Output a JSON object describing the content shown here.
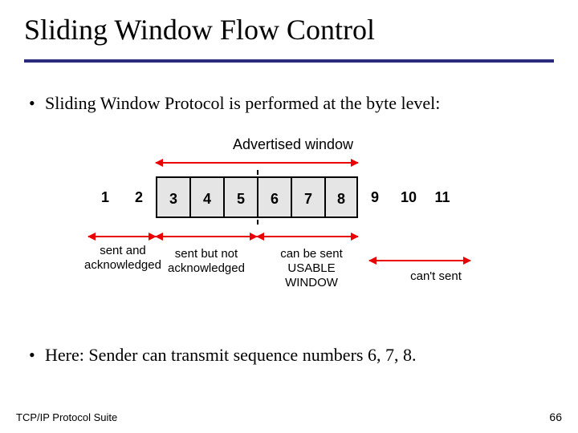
{
  "slide": {
    "title": "Sliding Window Flow Control",
    "bullet1": "Sliding Window Protocol is performed at the byte level:",
    "bullet2": "Here: Sender can transmit sequence numbers 6, 7, 8.",
    "footer_left": "TCP/IP Protocol Suite",
    "footer_right": "66"
  },
  "diagram": {
    "advertised_label": "Advertised window",
    "cells": [
      "1",
      "2",
      "3",
      "4",
      "5",
      "6",
      "7",
      "8",
      "9",
      "10",
      "11"
    ],
    "window_start_index": 2,
    "window_end_index": 7,
    "pointer_after_sent_index": 5,
    "labels": {
      "sent_ack": "sent and\nacknowledged",
      "sent_not_ack": "sent but not\nacknowledged",
      "usable": "can be sent\nUSABLE\nWINDOW",
      "cant_send": "can't sent"
    }
  },
  "chart_data": {
    "type": "diagram",
    "title": "Sliding Window Flow Control",
    "sequence_numbers": [
      1,
      2,
      3,
      4,
      5,
      6,
      7,
      8,
      9,
      10,
      11
    ],
    "sent_and_acknowledged": [
      1,
      2
    ],
    "sent_but_not_acknowledged": [
      3,
      4,
      5
    ],
    "usable_window": [
      6,
      7,
      8
    ],
    "cannot_send": [
      9,
      10,
      11
    ],
    "advertised_window": [
      3,
      4,
      5,
      6,
      7,
      8
    ]
  }
}
